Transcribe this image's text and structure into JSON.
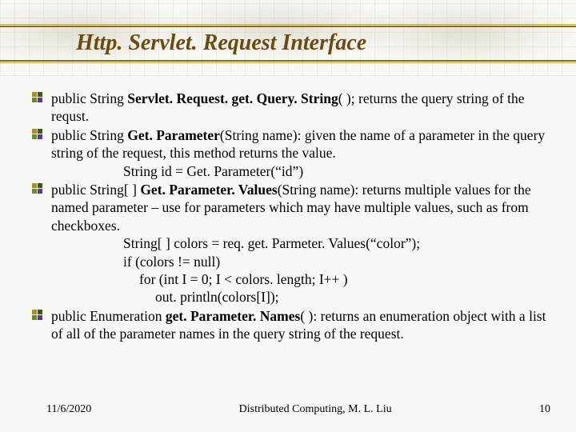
{
  "title": "Http. Servlet. Request Interface",
  "items": [
    {
      "prefix": "public String ",
      "bold": "Servlet. Request. get. Query. String",
      "rest": "( ); returns the query string of the requst."
    },
    {
      "prefix": "public String ",
      "bold": "Get. Parameter",
      "rest": "(String name): given the name of a parameter in the query string of the request, this method returns the value.",
      "code": [
        "String id = Get. Parameter(“id”)"
      ]
    },
    {
      "prefix": "public String[ ] ",
      "bold": "Get. Parameter. Values",
      "rest": "(String name): returns multiple values for the named parameter – use for parameters which may have multiple values, such as from checkboxes.",
      "code": [
        "String[ ] colors = req. get. Parmeter. Values(“color”);",
        "if (colors != null)",
        "   for (int I = 0; I < colors. length; I++ )",
        "      out. println(colors[I]);"
      ]
    },
    {
      "prefix": "public Enumeration ",
      "bold": "get. Parameter. Names",
      "rest": "( ): returns an enumeration object with a list of all of the parameter names in the query string of the request."
    }
  ],
  "footer": {
    "date": "11/6/2020",
    "center": "Distributed Computing, M. L. Liu",
    "page": "10"
  }
}
